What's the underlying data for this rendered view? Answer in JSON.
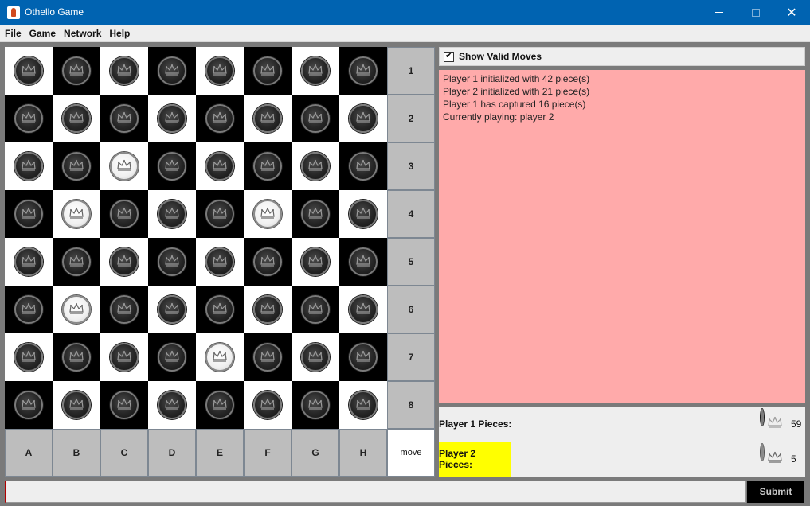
{
  "window": {
    "title": "Othello Game",
    "close_glyph": "✕"
  },
  "menu": [
    "File",
    "Game",
    "Network",
    "Help"
  ],
  "board": {
    "rows": [
      [
        "black",
        "black",
        "black",
        "black",
        "black",
        "black",
        "black",
        "black"
      ],
      [
        "black",
        "black",
        "black",
        "black",
        "black",
        "black",
        "black",
        "black"
      ],
      [
        "black",
        "black",
        "white",
        "black",
        "black",
        "black",
        "black",
        "black"
      ],
      [
        "black",
        "white",
        "black",
        "black",
        "black",
        "white",
        "black",
        "black"
      ],
      [
        "black",
        "black",
        "black",
        "black",
        "black",
        "black",
        "black",
        "black"
      ],
      [
        "black",
        "white",
        "black",
        "black",
        "black",
        "black",
        "black",
        "black"
      ],
      [
        "black",
        "black",
        "black",
        "black",
        "white",
        "black",
        "black",
        "black"
      ],
      [
        "black",
        "black",
        "black",
        "black",
        "black",
        "black",
        "black",
        "black"
      ]
    ],
    "row_labels": [
      "1",
      "2",
      "3",
      "4",
      "5",
      "6",
      "7",
      "8"
    ],
    "col_labels": [
      "A",
      "B",
      "C",
      "D",
      "E",
      "F",
      "G",
      "H"
    ],
    "corner_label": "move"
  },
  "controls": {
    "show_valid_moves_label": "Show Valid Moves",
    "show_valid_moves_checked": true
  },
  "log": [
    "Player 1 initialized with 42 piece(s)",
    "Player 2 initialized with 21 piece(s)",
    "Player 1 has captured 16 piece(s)",
    "Currently playing: player 2"
  ],
  "stats": {
    "p1": {
      "label": "Player 1 Pieces:",
      "count": "59",
      "piece": "black"
    },
    "p2": {
      "label": "Player 2 Pieces:",
      "count": "5",
      "piece": "white",
      "highlight": "#ffff00"
    }
  },
  "input": {
    "value": "",
    "submit_label": "Submit"
  },
  "colors": {
    "titlebar": "#0063b1",
    "log_bg": "#ffaaaa",
    "label_cell": "#bdbdbd"
  }
}
